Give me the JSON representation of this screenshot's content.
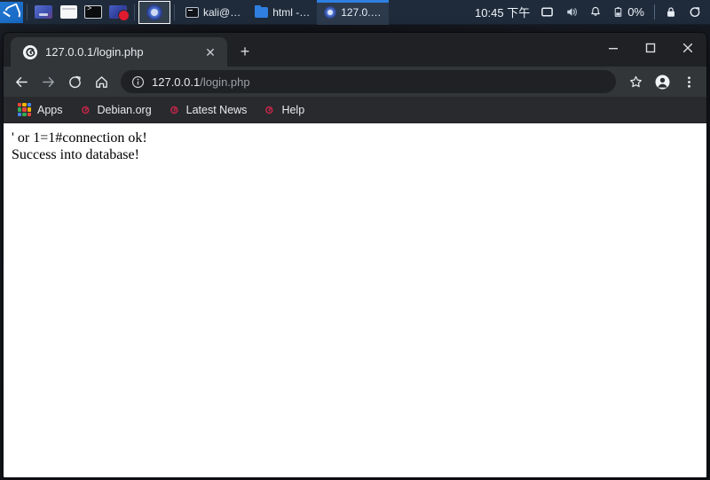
{
  "taskbar": {
    "menu_icon": "kali-dragon-logo",
    "launchers": [
      {
        "name": "blue-app-icon",
        "label": ""
      },
      {
        "name": "file-manager-icon",
        "label": ""
      },
      {
        "name": "terminal-icon",
        "label": ""
      },
      {
        "name": "app-with-badge-icon",
        "label": ""
      }
    ],
    "active_launcher": {
      "name": "chromium-icon",
      "label": ""
    },
    "windows": [
      {
        "icon": "terminal-icon",
        "label": "kali@…",
        "active": false
      },
      {
        "icon": "folder-icon",
        "label": "html -…",
        "active": false
      },
      {
        "icon": "chromium-icon",
        "label": "127.0.…",
        "active": true
      }
    ],
    "tray": {
      "clock": "10:45 下午",
      "display_icon": "display-icon",
      "volume_icon": "volume-icon",
      "notification_icon": "bell-icon",
      "battery_icon": "battery-icon",
      "battery_label": "0%",
      "lock_icon": "lock-icon",
      "logout_icon": "logout-icon"
    }
  },
  "browser": {
    "tabs": [
      {
        "title": "127.0.0.1/login.php",
        "favicon": "globe-swirl-icon",
        "close_label": "✕"
      }
    ],
    "new_tab_label": "+",
    "window_controls": {
      "minimize_label": "minimize-icon",
      "maximize_label": "maximize-icon",
      "close_label": "close-icon"
    },
    "toolbar": {
      "back_icon": "back-arrow-icon",
      "forward_icon": "forward-arrow-icon",
      "reload_icon": "reload-icon",
      "home_icon": "home-icon",
      "site_info_icon": "info-circle-icon",
      "url_host": "127.0.0.1",
      "url_path": "/login.php",
      "url_full": "127.0.0.1/login.php",
      "bookmark_icon": "star-icon",
      "profile_icon": "profile-avatar-icon",
      "menu_icon": "three-dot-menu-icon"
    },
    "bookmarks": [
      {
        "label": "Apps",
        "icon": "apps-grid-icon"
      },
      {
        "label": "Debian.org",
        "icon": "debian-swirl-icon"
      },
      {
        "label": "Latest News",
        "icon": "debian-swirl-icon"
      },
      {
        "label": "Help",
        "icon": "debian-swirl-icon"
      }
    ]
  },
  "page": {
    "lines": [
      "' or 1=1#connection ok!",
      "Success into database!"
    ],
    "line1": "' or 1=1#connection ok!",
    "line2": "Success into database!"
  },
  "colors": {
    "taskbar_bg": "#1f2b3a",
    "browser_bg": "#202124",
    "toolbar_bg": "#323639",
    "bookmarks_bg": "#292a2d",
    "accent_blue": "#2f7fe0",
    "debian_red": "#c2264a",
    "page_bg": "#ffffff"
  }
}
